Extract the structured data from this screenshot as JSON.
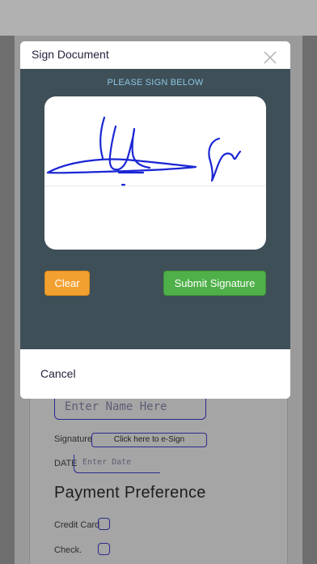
{
  "background_form": {
    "name_placeholder": "Enter Name Here",
    "signature_label": "Signature",
    "esign_button_label": "Click here to e-Sign",
    "date_label": "DATE",
    "date_placeholder": "Enter Date",
    "payment_title": "Payment Preference",
    "payment_options": [
      {
        "label": "Credit Card",
        "checked": false
      },
      {
        "label": "Check.",
        "checked": false
      }
    ]
  },
  "modal": {
    "title": "Sign Document",
    "close_icon": "close-icon",
    "instruction": "PLEASE SIGN BELOW",
    "clear_label": "Clear",
    "submit_label": "Submit Signature",
    "cancel_label": "Cancel"
  },
  "colors": {
    "modal_body": "#3e4f58",
    "instruction_text": "#8cc5e0",
    "clear_button": "#f2a131",
    "submit_button": "#4fb04a",
    "signature_ink": "#1a26d4",
    "form_accent": "#2c2a8e"
  }
}
